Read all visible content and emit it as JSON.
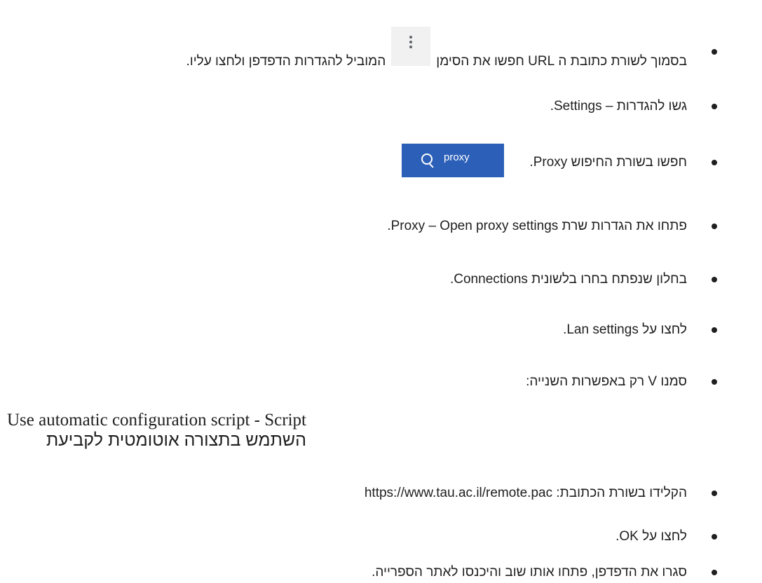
{
  "steps": [
    {
      "before_icon": "בסמוך לשורת כתובת ה URL חפשו את הסימן",
      "after_icon": "המוביל להגדרות הדפדפן ולחצו עליו.",
      "icon": "kebab-menu-icon"
    },
    {
      "text": "גשו להגדרות – Settings."
    },
    {
      "text": "חפשו בשורת החיפוש Proxy."
    },
    {
      "text": "פתחו את הגדרות שרת Proxy – Open proxy settings."
    },
    {
      "text": "בחלון שנפתח בחרו בלשונית Connections."
    },
    {
      "text": "לחצו על Lan settings."
    },
    {
      "text": "סמנו V רק באפשרות השנייה:"
    }
  ],
  "option_line": {
    "hebrew": "השתמש בתצורה אוטומטית לקביעת",
    "english": "Use automatic configuration script - Script"
  },
  "later_steps": [
    {
      "text": "הקלידו בשורת הכתובת: https://www.tau.ac.il/remote.pac"
    },
    {
      "text": "לחצו על OK."
    },
    {
      "text": "סגרו את הדפדפן, פתחו אותו שוב והיכנסו לאתר הספרייה."
    }
  ],
  "search_box": {
    "text": "proxy",
    "icon": "search-icon",
    "bg_color": "#2b5fb8"
  }
}
